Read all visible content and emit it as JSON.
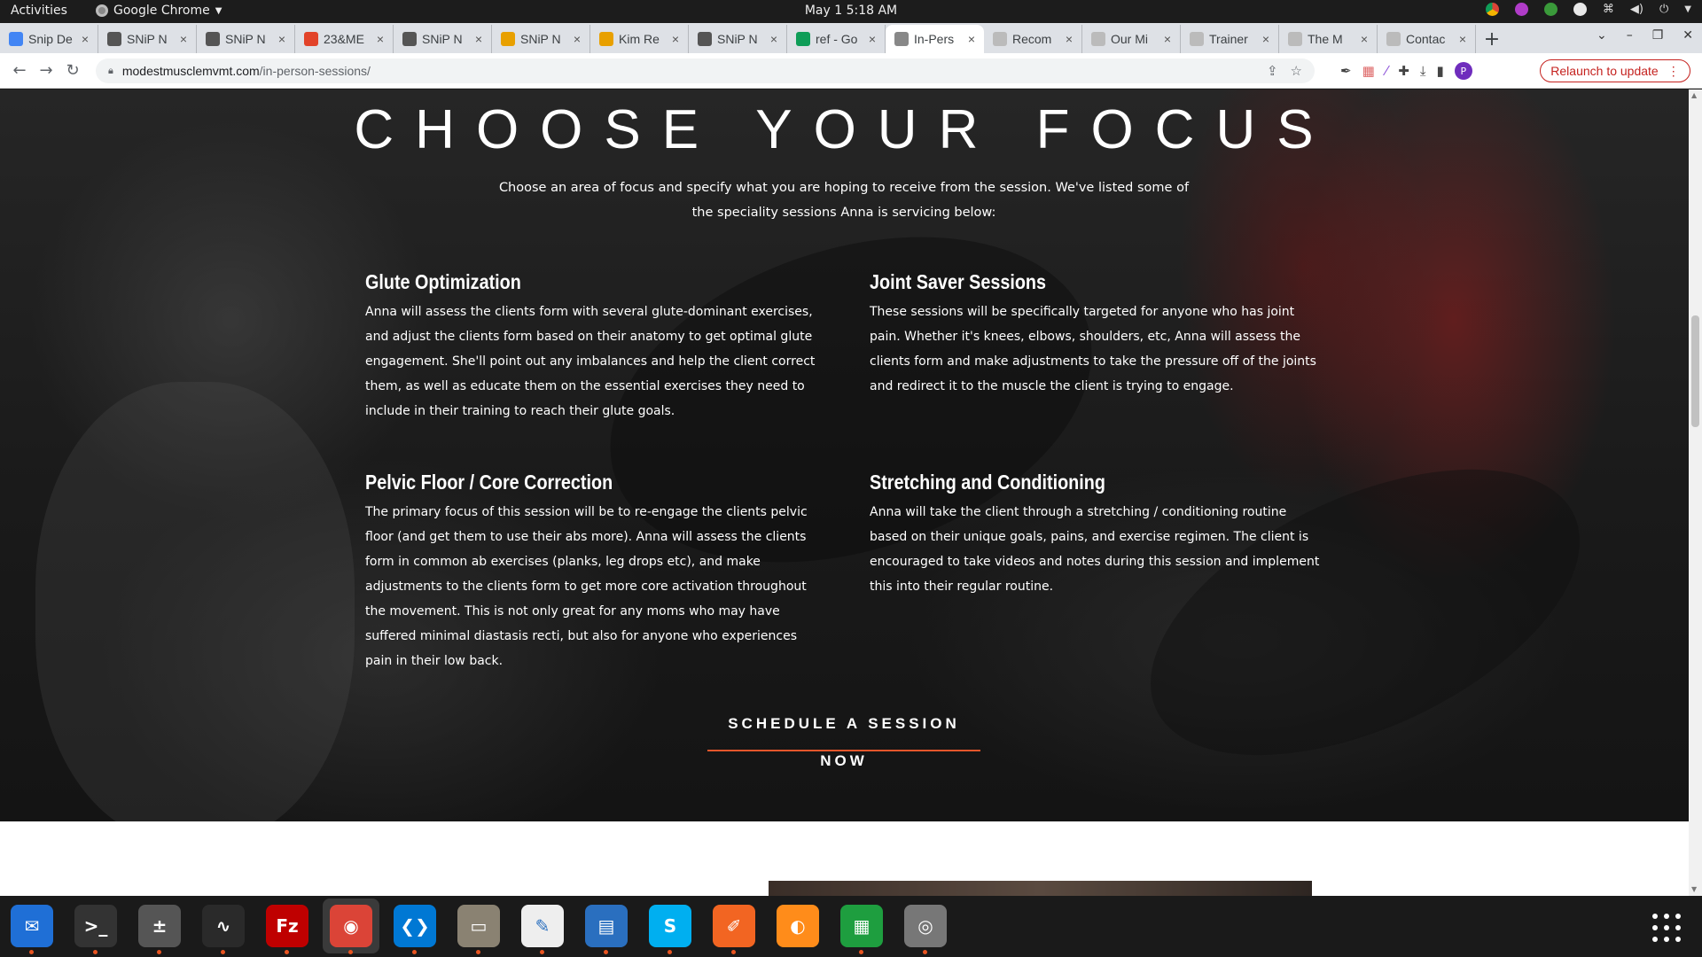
{
  "topbar": {
    "activities": "Activities",
    "app_name": "Google Chrome",
    "clock": "May 1  5:18 AM"
  },
  "tabs": [
    {
      "title": "Snip De",
      "icon": "docs-icon",
      "color": "#4285f4"
    },
    {
      "title": "SNiP N",
      "icon": "snip-icon",
      "color": "#555555"
    },
    {
      "title": "SNiP N",
      "icon": "snip-icon",
      "color": "#555555"
    },
    {
      "title": "23&ME",
      "icon": "gitlab-icon",
      "color": "#e24329"
    },
    {
      "title": "SNiP N",
      "icon": "snip-icon",
      "color": "#555555"
    },
    {
      "title": "SNiP N",
      "icon": "chrome-icon",
      "color": "#e8a000"
    },
    {
      "title": "Kim Re",
      "icon": "chrome-icon",
      "color": "#e8a000"
    },
    {
      "title": "SNiP N",
      "icon": "snip-icon",
      "color": "#555555"
    },
    {
      "title": "ref - Go",
      "icon": "sheets-icon",
      "color": "#0f9d58"
    },
    {
      "title": "In-Pers",
      "icon": "site-icon",
      "color": "#888888",
      "active": true
    },
    {
      "title": "Recom",
      "icon": "site-icon",
      "color": "#bbbbbb"
    },
    {
      "title": "Our Mi",
      "icon": "site-icon",
      "color": "#bbbbbb"
    },
    {
      "title": "Trainer",
      "icon": "site-icon",
      "color": "#bbbbbb"
    },
    {
      "title": "The M",
      "icon": "site-icon",
      "color": "#bbbbbb"
    },
    {
      "title": "Contac",
      "icon": "site-icon",
      "color": "#bbbbbb"
    }
  ],
  "address": {
    "host": "modestmusclemvmt.com",
    "path": "/in-person-sessions/"
  },
  "relaunch_label": "Relaunch to update",
  "profile_initial": "P",
  "page": {
    "title": "CHOOSE YOUR FOCUS",
    "intro": "Choose an area of focus and specify what you are hoping to receive from the session. We've listed some of the speciality sessions Anna is servicing below:",
    "services": [
      {
        "heading": "Glute Optimization",
        "body": "Anna will assess the clients form with several glute-dominant exercises, and adjust the clients form based on their anatomy to get optimal glute engagement. She'll point out any imbalances and help the client correct them, as well as educate them on the essential exercises they need to include in their training to reach their glute goals."
      },
      {
        "heading": "Joint Saver Sessions",
        "body": "These sessions will be specifically targeted for anyone who has joint pain. Whether it's knees, elbows, shoulders, etc, Anna will assess the clients form and make adjustments to take the pressure off of the joints and redirect it to the muscle the client is trying to engage."
      },
      {
        "heading": "Pelvic Floor / Core Correction",
        "body": "The primary focus of this session will be to re-engage the clients pelvic floor (and get them to use their abs more). Anna will assess the clients form in common ab exercises (planks, leg drops etc), and make adjustments to the clients form to get more core activation throughout the movement. This is not only great for any moms who may have suffered minimal diastasis recti, but also for anyone who experiences pain in their low back."
      },
      {
        "heading": "Stretching and Conditioning",
        "body": "Anna will take the client through a stretching / conditioning routine based on their unique goals, pains, and exercise regimen. The client is encouraged to take videos and notes during this session and implement this into their regular routine."
      }
    ],
    "cta": "SCHEDULE A SESSION NOW",
    "accent_color": "#e3562b"
  },
  "dock": [
    {
      "name": "thunderbird-icon",
      "glyph": "✉",
      "bg": "#1f6fd6",
      "running": true
    },
    {
      "name": "terminal-icon",
      "glyph": ">_",
      "bg": "#333333",
      "running": true
    },
    {
      "name": "calculator-icon",
      "glyph": "±",
      "bg": "#555555",
      "running": true
    },
    {
      "name": "system-monitor-icon",
      "glyph": "∿",
      "bg": "#2a2a2a",
      "running": true
    },
    {
      "name": "filezilla-icon",
      "glyph": "Fz",
      "bg": "#bf0000",
      "running": true
    },
    {
      "name": "chrome-icon",
      "glyph": "◉",
      "bg": "#db4437",
      "running": true
    },
    {
      "name": "vscode-icon",
      "glyph": "❮❯",
      "bg": "#0078d4",
      "running": true
    },
    {
      "name": "files-icon",
      "glyph": "▭",
      "bg": "#8a8272",
      "running": true
    },
    {
      "name": "text-editor-icon",
      "glyph": "✎",
      "bg": "#eeeeee",
      "running": true
    },
    {
      "name": "document-viewer-icon",
      "glyph": "▤",
      "bg": "#2a6fbf",
      "running": true
    },
    {
      "name": "skype-icon",
      "glyph": "S",
      "bg": "#00aff0",
      "running": true
    },
    {
      "name": "drawing-icon",
      "glyph": "✐",
      "bg": "#f26522",
      "running": true
    },
    {
      "name": "firefox-dev-icon",
      "glyph": "◐",
      "bg": "#ff8c1a",
      "running": false
    },
    {
      "name": "spreadsheet-icon",
      "glyph": "▦",
      "bg": "#1e9e3f",
      "running": true
    },
    {
      "name": "disk-icon",
      "glyph": "◎",
      "bg": "#777777",
      "running": true
    }
  ]
}
